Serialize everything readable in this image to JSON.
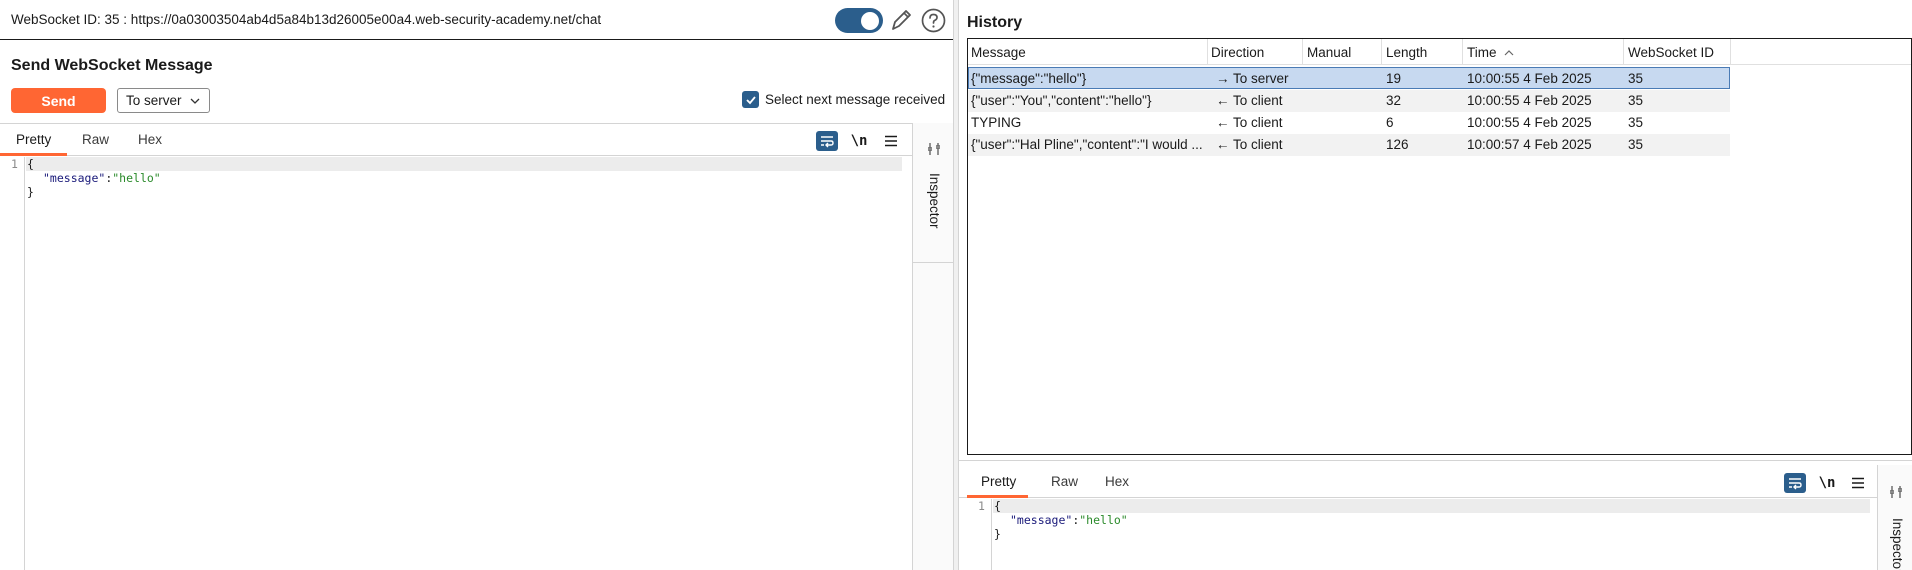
{
  "left": {
    "ws_info": "WebSocket ID: 35 : https://0a03003504ab4d5a84b13d26005e00a4.web-security-academy.net/chat",
    "send_title": "Send WebSocket Message",
    "send_label": "Send",
    "destination": "To server",
    "select_next_label": "Select next message received",
    "tabs": [
      "Pretty",
      "Raw",
      "Hex"
    ],
    "newline_label": "\\n",
    "inspector_label": "Inspector",
    "lines": [
      {
        "num": "1",
        "text": "{"
      },
      {
        "num": "",
        "key": "\"message\"",
        "sep": ":",
        "val": "\"hello\""
      },
      {
        "num": "",
        "text": "}"
      }
    ]
  },
  "history": {
    "title": "History",
    "columns": [
      "Message",
      "Direction",
      "Manual",
      "Length",
      "Time",
      "WebSocket ID"
    ],
    "sort_column": "Time",
    "rows": [
      {
        "message": "{\"message\":\"hello\"}",
        "arrow": "→",
        "direction": "To server",
        "manual": "",
        "length": "19",
        "time": "10:00:55 4 Feb 2025",
        "ws_id": "35"
      },
      {
        "message": "{\"user\":\"You\",\"content\":\"hello\"}",
        "arrow": "←",
        "direction": "To client",
        "manual": "",
        "length": "32",
        "time": "10:00:55 4 Feb 2025",
        "ws_id": "35"
      },
      {
        "message": "TYPING",
        "arrow": "←",
        "direction": "To client",
        "manual": "",
        "length": "6",
        "time": "10:00:55 4 Feb 2025",
        "ws_id": "35"
      },
      {
        "message": "{\"user\":\"Hal Pline\",\"content\":\"I would ...",
        "arrow": "←",
        "direction": "To client",
        "manual": "",
        "length": "126",
        "time": "10:00:57 4 Feb 2025",
        "ws_id": "35"
      }
    ]
  },
  "right_editor": {
    "tabs": [
      "Pretty",
      "Raw",
      "Hex"
    ],
    "newline_label": "\\n",
    "inspector_label": "Inspector",
    "lines": [
      {
        "num": "1",
        "text": "{"
      },
      {
        "num": "",
        "key": "\"message\"",
        "sep": ":",
        "val": "\"hello\""
      },
      {
        "num": "",
        "text": "}"
      }
    ]
  },
  "colors": {
    "accent": "#ff6633",
    "toggle": "#2b5e8c",
    "selected_row": "#c7d9f0"
  }
}
